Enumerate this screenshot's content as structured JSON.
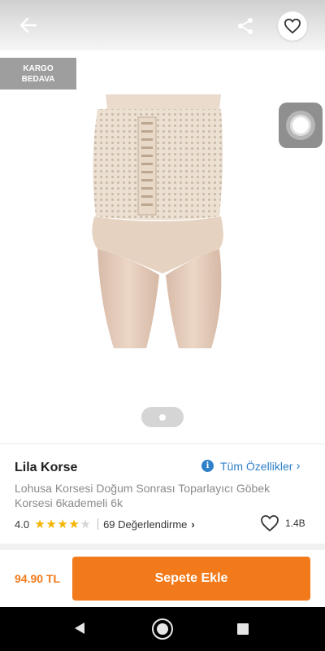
{
  "header": {
    "back_icon": "arrow-left-icon",
    "share_icon": "share-icon",
    "favorite_icon": "heart-outline-icon"
  },
  "badge": {
    "line1": "KARGO",
    "line2": "BEDAVA"
  },
  "gallery": {
    "current_page": 1,
    "total_pages": 1
  },
  "product": {
    "brand": "Lila Korse",
    "title": "Lohusa Korsesi Doğum Sonrası Toparlayıcı Göbek Korsesi 6kademeli 6k",
    "features_link": "Tüm Özellikler",
    "features_chevron": "›",
    "rating": {
      "value": "4.0",
      "stars_filled": 4,
      "stars_total": 5,
      "reviews_label": "69 Değerlendirme",
      "reviews_chevron": "›"
    },
    "favorite_count": "1.4B"
  },
  "purchase": {
    "price": "94.90 TL",
    "add_to_cart_label": "Sepete Ekle"
  },
  "colors": {
    "accent": "#f27a1a",
    "link": "#2f80c8",
    "star": "#f4b400",
    "badge_bg": "#9e9e9e"
  }
}
